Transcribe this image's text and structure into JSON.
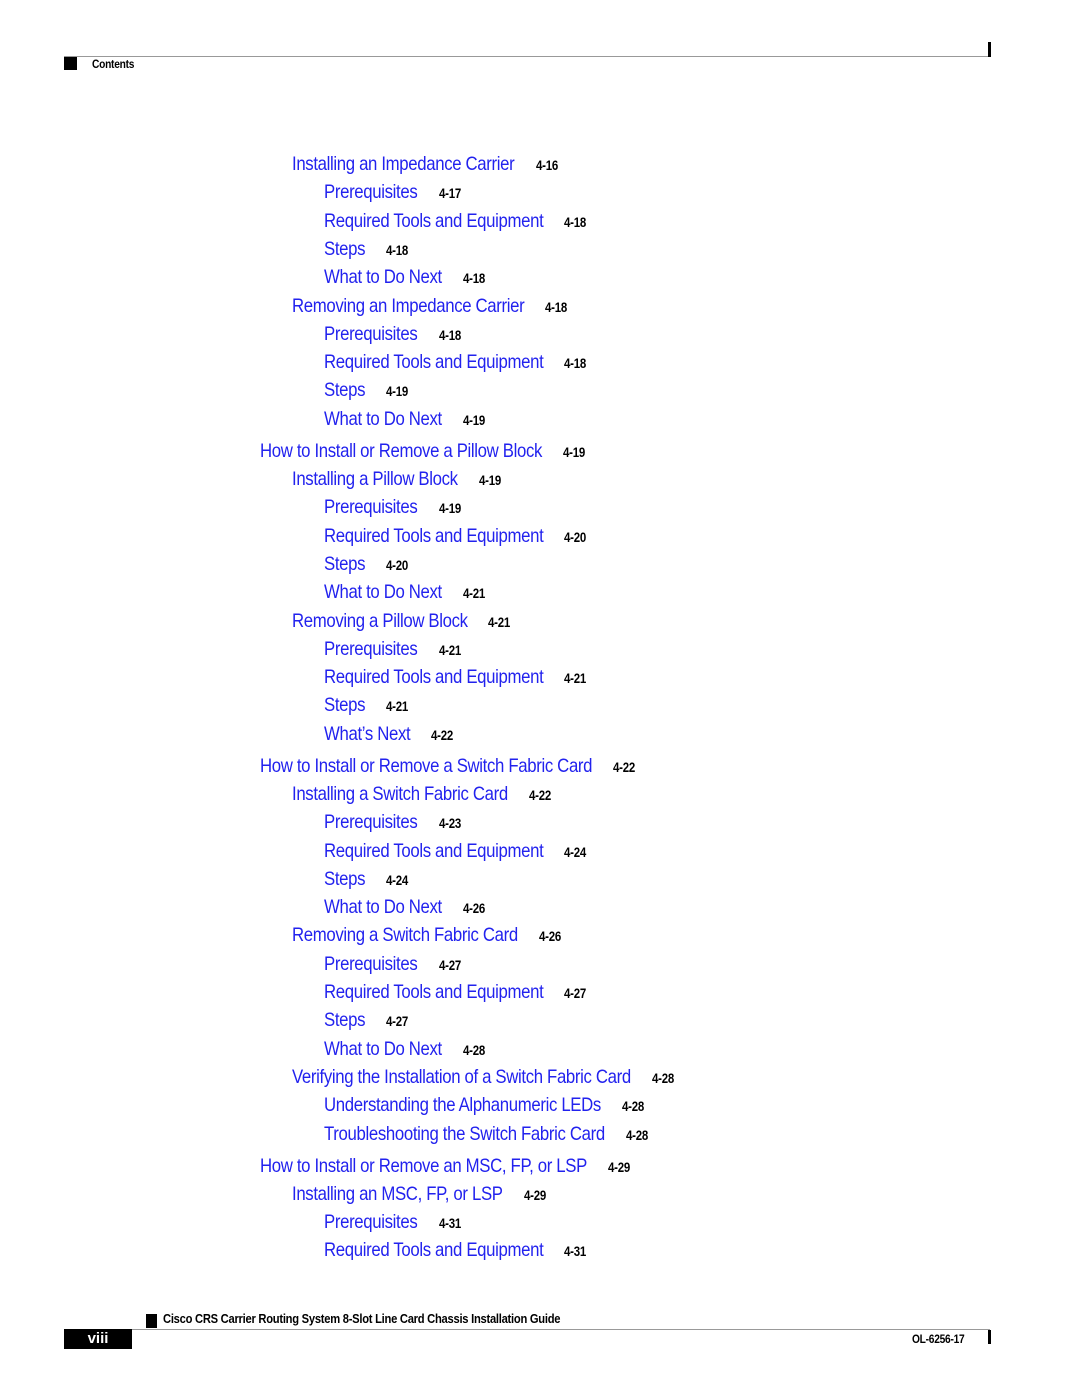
{
  "header": {
    "section_label": "Contents"
  },
  "toc": [
    {
      "level": 2,
      "title": "Installing an Impedance Carrier",
      "page": "4-16"
    },
    {
      "level": 3,
      "title": "Prerequisites",
      "page": "4-17"
    },
    {
      "level": 3,
      "title": "Required Tools and Equipment",
      "page": "4-18"
    },
    {
      "level": 3,
      "title": "Steps",
      "page": "4-18"
    },
    {
      "level": 3,
      "title": "What to Do Next",
      "page": "4-18"
    },
    {
      "level": 2,
      "title": "Removing an Impedance Carrier",
      "page": "4-18"
    },
    {
      "level": 3,
      "title": "Prerequisites",
      "page": "4-18"
    },
    {
      "level": 3,
      "title": "Required Tools and Equipment",
      "page": "4-18"
    },
    {
      "level": 3,
      "title": "Steps",
      "page": "4-19"
    },
    {
      "level": 3,
      "title": "What to Do Next",
      "page": "4-19"
    },
    {
      "level": 1,
      "title": "How to Install or Remove a Pillow Block",
      "page": "4-19"
    },
    {
      "level": 2,
      "title": "Installing a Pillow Block",
      "page": "4-19"
    },
    {
      "level": 3,
      "title": "Prerequisites",
      "page": "4-19"
    },
    {
      "level": 3,
      "title": "Required Tools and Equipment",
      "page": "4-20"
    },
    {
      "level": 3,
      "title": "Steps",
      "page": "4-20"
    },
    {
      "level": 3,
      "title": "What to Do Next",
      "page": "4-21"
    },
    {
      "level": 2,
      "title": "Removing a Pillow Block",
      "page": "4-21"
    },
    {
      "level": 3,
      "title": "Prerequisites",
      "page": "4-21"
    },
    {
      "level": 3,
      "title": "Required Tools and Equipment",
      "page": "4-21"
    },
    {
      "level": 3,
      "title": "Steps",
      "page": "4-21"
    },
    {
      "level": 3,
      "title": "What’s Next",
      "page": "4-22"
    },
    {
      "level": 1,
      "title": "How to Install or Remove a Switch Fabric Card",
      "page": "4-22"
    },
    {
      "level": 2,
      "title": "Installing a Switch Fabric Card",
      "page": "4-22"
    },
    {
      "level": 3,
      "title": "Prerequisites",
      "page": "4-23"
    },
    {
      "level": 3,
      "title": "Required Tools and Equipment",
      "page": "4-24"
    },
    {
      "level": 3,
      "title": "Steps",
      "page": "4-24"
    },
    {
      "level": 3,
      "title": "What to Do Next",
      "page": "4-26"
    },
    {
      "level": 2,
      "title": "Removing a Switch Fabric Card",
      "page": "4-26"
    },
    {
      "level": 3,
      "title": "Prerequisites",
      "page": "4-27"
    },
    {
      "level": 3,
      "title": "Required Tools and Equipment",
      "page": "4-27"
    },
    {
      "level": 3,
      "title": "Steps",
      "page": "4-27"
    },
    {
      "level": 3,
      "title": "What to Do Next",
      "page": "4-28"
    },
    {
      "level": 2,
      "title": "Verifying the Installation of a Switch Fabric Card",
      "page": "4-28"
    },
    {
      "level": 3,
      "title": "Understanding the Alphanumeric LEDs",
      "page": "4-28"
    },
    {
      "level": 3,
      "title": "Troubleshooting the Switch Fabric Card",
      "page": "4-28"
    },
    {
      "level": 1,
      "title": "How to Install or Remove an MSC, FP, or LSP",
      "page": "4-29"
    },
    {
      "level": 2,
      "title": "Installing an MSC, FP, or LSP",
      "page": "4-29"
    },
    {
      "level": 3,
      "title": "Prerequisites",
      "page": "4-31"
    },
    {
      "level": 3,
      "title": "Required Tools and Equipment",
      "page": "4-31"
    }
  ],
  "footer": {
    "book_title": "Cisco CRS Carrier Routing System 8-Slot Line Card Chassis Installation Guide",
    "page_number": "viii",
    "doc_number": "OL-6256-17"
  },
  "colors": {
    "link": "#2222ee",
    "page_ref": "#000000"
  }
}
